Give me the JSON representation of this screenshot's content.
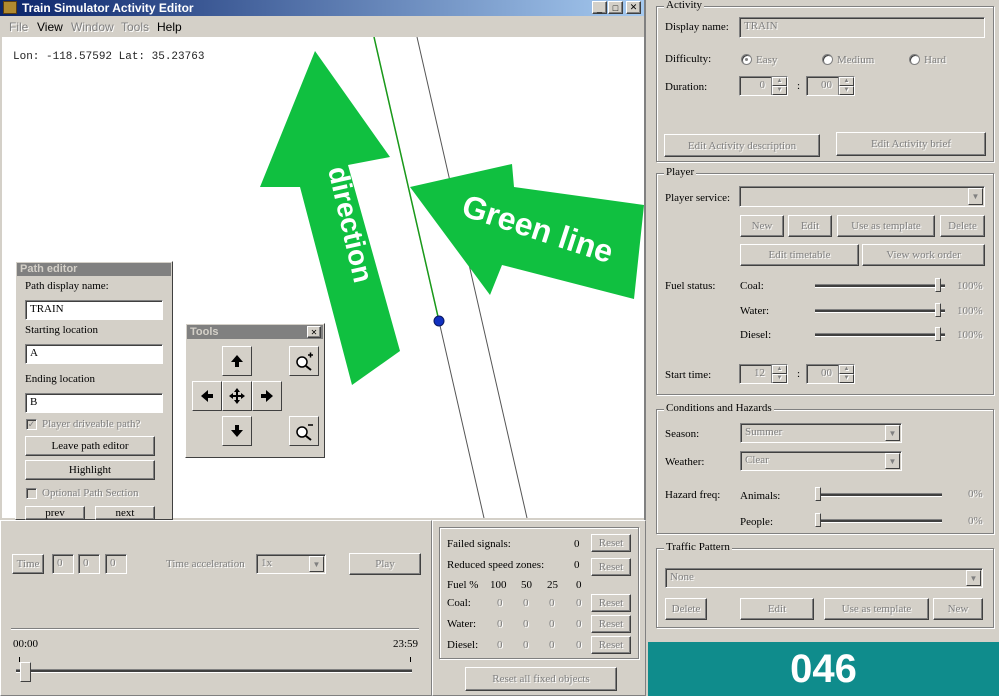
{
  "window": {
    "title": "Train Simulator Activity Editor"
  },
  "menu": [
    "File",
    "View",
    "Window",
    "Tools",
    "Help"
  ],
  "map": {
    "coords": "Lon: -118.57592 Lat: 35.23763"
  },
  "annotations": {
    "direction": "direction",
    "green_line": "Green line"
  },
  "path_editor": {
    "title": "Path editor",
    "display_name_label": "Path display name:",
    "display_name_value": "TRAIN",
    "start_label": "Starting location",
    "start_value": "A",
    "end_label": "Ending location",
    "end_value": "B",
    "driveable_label": "Player driveable path?",
    "leave_button": "Leave path editor",
    "highlight_button": "Highlight",
    "optional_label": "Optional Path Section",
    "prev_button": "prev",
    "next_button": "next"
  },
  "tools": {
    "title": "Tools",
    "close": "✕"
  },
  "timebar": {
    "time_label": "Time",
    "time_values": [
      "0",
      "0",
      "0"
    ],
    "accel_label": "Time acceleration",
    "accel_value": "1x",
    "play_button": "Play",
    "start_time": "00:00",
    "end_time": "23:59",
    "timeline_position": 0.02
  },
  "stats": {
    "failed_signals_label": "Failed signals:",
    "failed_signals_value": "0",
    "reduced_speed_label": "Reduced speed zones:",
    "reduced_speed_value": "0",
    "fuel_header": "Fuel %",
    "fuel_cols": [
      "100",
      "50",
      "25",
      "0"
    ],
    "rows": [
      {
        "label": "Coal:",
        "values": [
          "0",
          "0",
          "0",
          "0"
        ]
      },
      {
        "label": "Water:",
        "values": [
          "0",
          "0",
          "0",
          "0"
        ]
      },
      {
        "label": "Diesel:",
        "values": [
          "0",
          "0",
          "0",
          "0"
        ]
      }
    ],
    "reset_label": "Reset",
    "reset_all_button": "Reset all fixed objects"
  },
  "activity": {
    "group_label": "Activity",
    "display_name_label": "Display name:",
    "display_name_value": "TRAIN",
    "difficulty_label": "Difficulty:",
    "difficulty_options": [
      "Easy",
      "Medium",
      "Hard"
    ],
    "difficulty_selected": "Easy",
    "duration_label": "Duration:",
    "duration_hours": "0",
    "duration_minutes": "00",
    "edit_description_button": "Edit Activity description",
    "edit_brief_button": "Edit Activity brief"
  },
  "player": {
    "group_label": "Player",
    "service_label": "Player service:",
    "service_value": "",
    "new_button": "New",
    "edit_button": "Edit",
    "use_template_button": "Use as template",
    "delete_button": "Delete",
    "edit_timetable_button": "Edit timetable",
    "view_work_order_button": "View work order",
    "fuel_status_label": "Fuel status:",
    "fuel": [
      {
        "label": "Coal:",
        "value": "100%",
        "level": 1.0
      },
      {
        "label": "Water:",
        "value": "100%",
        "level": 1.0
      },
      {
        "label": "Diesel:",
        "value": "100%",
        "level": 1.0
      }
    ],
    "start_time_label": "Start time:",
    "start_hours": "12",
    "start_minutes": "00"
  },
  "conditions": {
    "group_label": "Conditions and Hazards",
    "season_label": "Season:",
    "season_value": "Summer",
    "weather_label": "Weather:",
    "weather_value": "Clear",
    "hazard_label": "Hazard freq:",
    "animals_label": "Animals:",
    "animals_value": "0%",
    "animals_level": 0,
    "people_label": "People:",
    "people_value": "0%",
    "people_level": 0
  },
  "traffic": {
    "group_label": "Traffic Pattern",
    "value": "None",
    "delete_button": "Delete",
    "edit_button": "Edit",
    "use_template_button": "Use as template",
    "new_button": "New"
  },
  "badge": {
    "number": "046",
    "color": "#0f8c8c"
  }
}
